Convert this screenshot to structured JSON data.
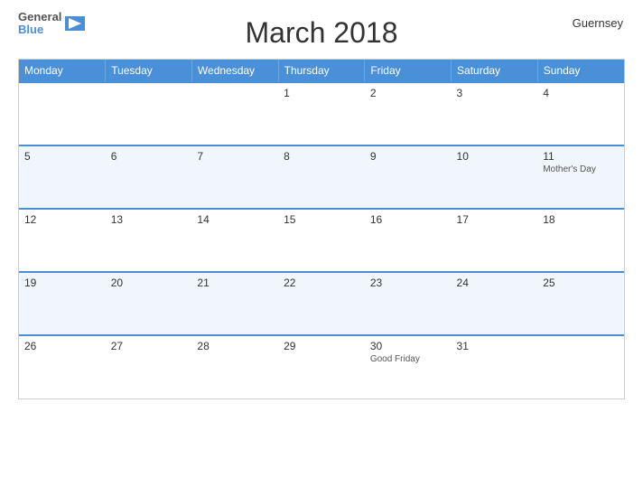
{
  "logo": {
    "general": "General",
    "blue": "Blue"
  },
  "country": "Guernsey",
  "title": "March 2018",
  "headers": [
    "Monday",
    "Tuesday",
    "Wednesday",
    "Thursday",
    "Friday",
    "Saturday",
    "Sunday"
  ],
  "weeks": [
    [
      {
        "day": "",
        "event": ""
      },
      {
        "day": "",
        "event": ""
      },
      {
        "day": "",
        "event": ""
      },
      {
        "day": "1",
        "event": ""
      },
      {
        "day": "2",
        "event": ""
      },
      {
        "day": "3",
        "event": ""
      },
      {
        "day": "4",
        "event": ""
      }
    ],
    [
      {
        "day": "5",
        "event": ""
      },
      {
        "day": "6",
        "event": ""
      },
      {
        "day": "7",
        "event": ""
      },
      {
        "day": "8",
        "event": ""
      },
      {
        "day": "9",
        "event": ""
      },
      {
        "day": "10",
        "event": ""
      },
      {
        "day": "11",
        "event": "Mother's Day"
      }
    ],
    [
      {
        "day": "12",
        "event": ""
      },
      {
        "day": "13",
        "event": ""
      },
      {
        "day": "14",
        "event": ""
      },
      {
        "day": "15",
        "event": ""
      },
      {
        "day": "16",
        "event": ""
      },
      {
        "day": "17",
        "event": ""
      },
      {
        "day": "18",
        "event": ""
      }
    ],
    [
      {
        "day": "19",
        "event": ""
      },
      {
        "day": "20",
        "event": ""
      },
      {
        "day": "21",
        "event": ""
      },
      {
        "day": "22",
        "event": ""
      },
      {
        "day": "23",
        "event": ""
      },
      {
        "day": "24",
        "event": ""
      },
      {
        "day": "25",
        "event": ""
      }
    ],
    [
      {
        "day": "26",
        "event": ""
      },
      {
        "day": "27",
        "event": ""
      },
      {
        "day": "28",
        "event": ""
      },
      {
        "day": "29",
        "event": ""
      },
      {
        "day": "30",
        "event": "Good Friday"
      },
      {
        "day": "31",
        "event": ""
      },
      {
        "day": "",
        "event": ""
      }
    ]
  ]
}
